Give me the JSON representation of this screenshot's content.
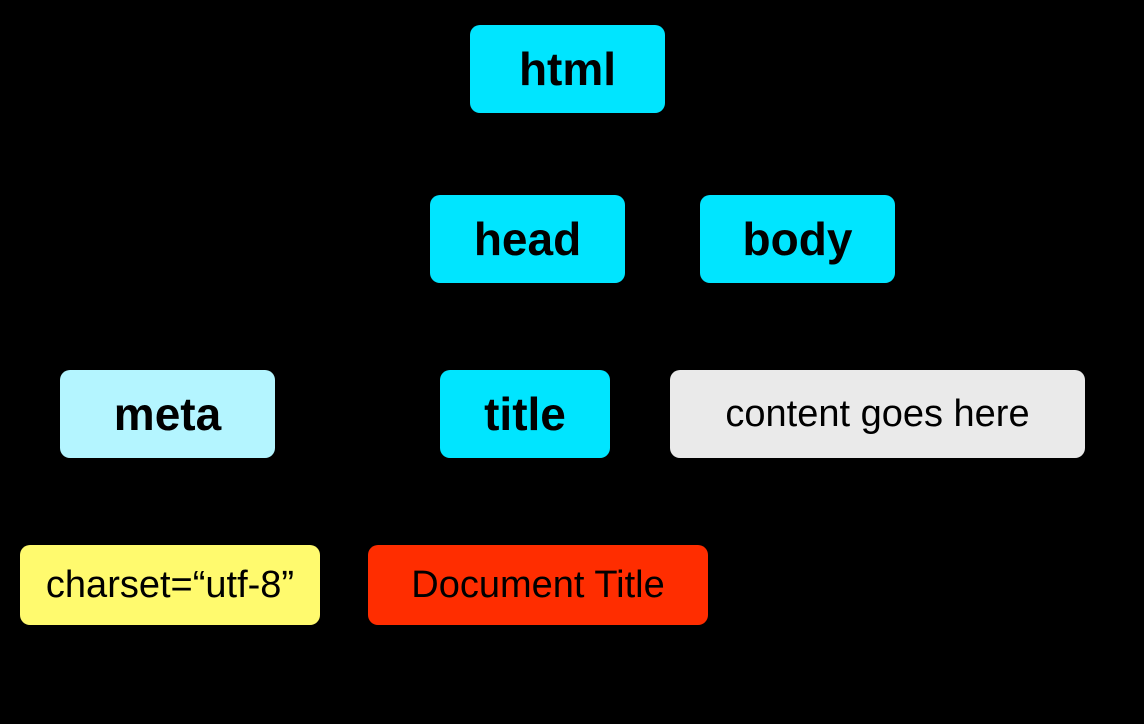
{
  "diagram": {
    "root": {
      "label": "html"
    },
    "level2": {
      "head": {
        "label": "head"
      },
      "body": {
        "label": "body"
      }
    },
    "level3": {
      "meta": {
        "label": "meta"
      },
      "title": {
        "label": "title"
      },
      "content": {
        "label": "content goes here"
      }
    },
    "level4": {
      "charset": {
        "label": "charset=“utf-8”"
      },
      "doctitle": {
        "label": "Document Title"
      }
    }
  },
  "colors": {
    "element_node": "#00E5FF",
    "element_node_light": "#B4F5FF",
    "attribute_node": "#FFFA6E",
    "text_node": "#FF2D00",
    "placeholder_node": "#EAEAEA"
  }
}
